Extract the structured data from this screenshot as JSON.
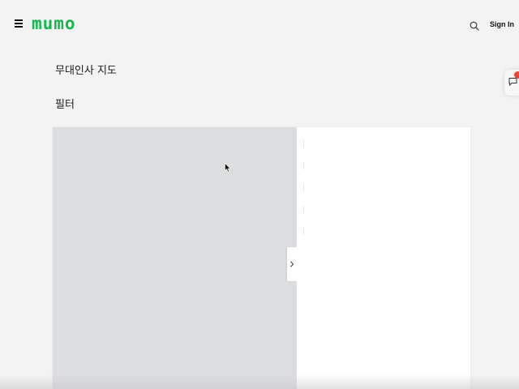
{
  "header": {
    "logo_text": "mumo",
    "logo_color": "#16b84e",
    "menu_icon": "hamburger-menu-icon",
    "search_icon": "search-icon",
    "signin_label": "Sign In"
  },
  "main": {
    "page_title": "무대인사 지도",
    "filter_title": "필터"
  },
  "map": {
    "background_color": "#dcdddf",
    "toggle_icon": "chevron-right-icon"
  },
  "chat": {
    "icon": "chat-bubble-icon",
    "badge_color": "#e8483a"
  }
}
